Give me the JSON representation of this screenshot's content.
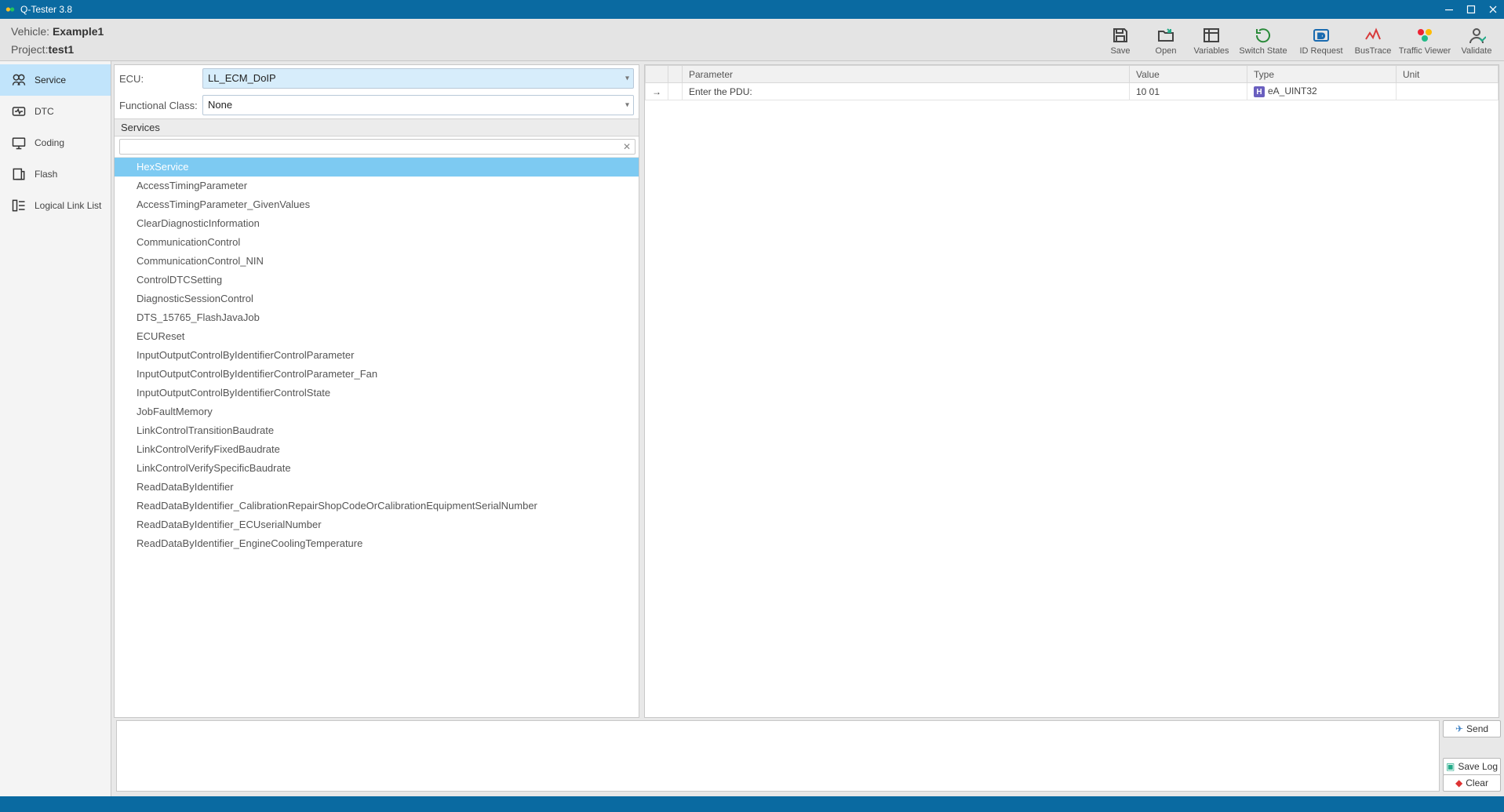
{
  "app": {
    "title": "Q-Tester  3.8"
  },
  "header": {
    "vehicle_label": "Vehicle:",
    "vehicle_value": "Example1",
    "project_label": "Project:",
    "project_value": "test1"
  },
  "toolbar": {
    "save": "Save",
    "open": "Open",
    "variables": "Variables",
    "switch_state": "Switch State",
    "id_request": "ID Request",
    "bustrace": "BusTrace",
    "traffic_viewer": "Traffic Viewer",
    "validate": "Validate"
  },
  "sidebar": {
    "items": [
      {
        "id": "service",
        "label": "Service",
        "active": true
      },
      {
        "id": "dtc",
        "label": "DTC",
        "active": false
      },
      {
        "id": "coding",
        "label": "Coding",
        "active": false
      },
      {
        "id": "flash",
        "label": "Flash",
        "active": false
      },
      {
        "id": "logical-link-list",
        "label": "Logical Link List",
        "active": false
      }
    ]
  },
  "ecu_panel": {
    "ecu_label": "ECU:",
    "ecu_value": "LL_ECM_DoIP",
    "func_class_label": "Functional Class:",
    "func_class_value": "None",
    "services_header": "Services",
    "filter_placeholder": "",
    "selected_index": 0,
    "services": [
      "HexService",
      "AccessTimingParameter",
      "AccessTimingParameter_GivenValues",
      "ClearDiagnosticInformation",
      "CommunicationControl",
      "CommunicationControl_NIN",
      "ControlDTCSetting",
      "DiagnosticSessionControl",
      "DTS_15765_FlashJavaJob",
      "ECUReset",
      "InputOutputControlByIdentifierControlParameter",
      "InputOutputControlByIdentifierControlParameter_Fan",
      "InputOutputControlByIdentifierControlState",
      "JobFaultMemory",
      "LinkControlTransitionBaudrate",
      "LinkControlVerifyFixedBaudrate",
      "LinkControlVerifySpecificBaudrate",
      "ReadDataByIdentifier",
      "ReadDataByIdentifier_CalibrationRepairShopCodeOrCalibrationEquipmentSerialNumber",
      "ReadDataByIdentifier_ECUserialNumber",
      "ReadDataByIdentifier_EngineCoolingTemperature"
    ]
  },
  "param_table": {
    "headers": {
      "parameter": "Parameter",
      "value": "Value",
      "type": "Type",
      "unit": "Unit"
    },
    "rows": [
      {
        "indicator": "→",
        "parameter": "Enter the PDU:",
        "value": "10 01",
        "type_badge": "H",
        "type": "eA_UINT32",
        "unit": ""
      }
    ]
  },
  "actions": {
    "send": "Send",
    "save_log": "Save Log",
    "clear": "Clear"
  }
}
